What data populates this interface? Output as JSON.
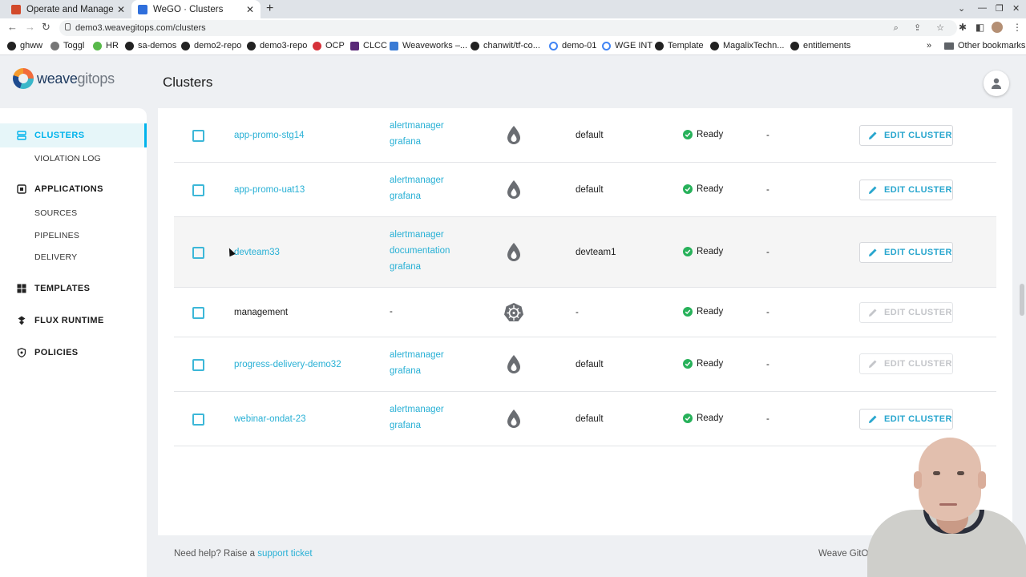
{
  "browser": {
    "tabs": [
      {
        "title": "Operate and Manage Kub",
        "active": false,
        "favicon_color": "#d24a2b"
      },
      {
        "title": "WeGO · Clusters",
        "active": true,
        "favicon_color": "#2f6fdc"
      }
    ],
    "url": "demo3.weavegitops.com/clusters",
    "bookmarks": [
      {
        "label": "ghww",
        "icon": "github-icon"
      },
      {
        "label": "Toggl",
        "icon": "toggl-icon"
      },
      {
        "label": "HR",
        "icon": "hr-icon"
      },
      {
        "label": "sa-demos",
        "icon": "github-icon"
      },
      {
        "label": "demo2-repo",
        "icon": "github-icon"
      },
      {
        "label": "demo3-repo",
        "icon": "github-icon"
      },
      {
        "label": "OCP",
        "icon": "openshift-icon"
      },
      {
        "label": "CLCC",
        "icon": "clcc-icon"
      },
      {
        "label": "Weaveworks –...",
        "icon": "weaveworks-icon"
      },
      {
        "label": "chanwit/tf-co...",
        "icon": "github-icon"
      },
      {
        "label": "demo-01",
        "icon": "google-icon"
      },
      {
        "label": "WGE INT",
        "icon": "google-icon"
      },
      {
        "label": "Template",
        "icon": "github-icon"
      },
      {
        "label": "MagalixTechn...",
        "icon": "github-icon"
      },
      {
        "label": "entitlements",
        "icon": "github-icon"
      }
    ],
    "bookmarks_more": "»",
    "other_bookmarks": "Other bookmarks"
  },
  "app": {
    "logo_weave": "weave",
    "logo_gitops": "gitops",
    "page_title": "Clusters"
  },
  "sidebar": {
    "items": [
      {
        "label": "CLUSTERS",
        "icon": "clusters-icon",
        "active": true
      },
      {
        "label": "VIOLATION LOG",
        "sub": true
      },
      {
        "label": "APPLICATIONS",
        "icon": "applications-icon"
      },
      {
        "label": "SOURCES",
        "sub": true
      },
      {
        "label": "PIPELINES",
        "sub": true
      },
      {
        "label": "DELIVERY",
        "sub": true
      },
      {
        "label": "TEMPLATES",
        "icon": "templates-icon"
      },
      {
        "label": "FLUX RUNTIME",
        "icon": "flux-icon"
      },
      {
        "label": "POLICIES",
        "icon": "policies-icon"
      }
    ]
  },
  "clusters": {
    "rows": [
      {
        "name": "app-promo-stg14",
        "name_is_link": true,
        "apps": [
          "alertmanager",
          "grafana"
        ],
        "type_icon": "vcluster-icon",
        "namespace": "default",
        "status": "Ready",
        "pr": "-",
        "edit_label": "EDIT CLUSTER",
        "edit_enabled": true
      },
      {
        "name": "app-promo-uat13",
        "name_is_link": true,
        "apps": [
          "alertmanager",
          "grafana"
        ],
        "type_icon": "vcluster-icon",
        "namespace": "default",
        "status": "Ready",
        "pr": "-",
        "edit_label": "EDIT CLUSTER",
        "edit_enabled": true
      },
      {
        "name": "devteam33",
        "name_is_link": true,
        "apps": [
          "alertmanager",
          "documentation",
          "grafana"
        ],
        "type_icon": "vcluster-icon",
        "namespace": "devteam1",
        "status": "Ready",
        "pr": "-",
        "edit_label": "EDIT CLUSTER",
        "edit_enabled": true
      },
      {
        "name": "management",
        "name_is_link": false,
        "apps": [
          "-"
        ],
        "type_icon": "kubernetes-icon",
        "namespace": "-",
        "status": "Ready",
        "pr": "-",
        "edit_label": "EDIT CLUSTER",
        "edit_enabled": false
      },
      {
        "name": "progress-delivery-demo32",
        "name_is_link": true,
        "apps": [
          "alertmanager",
          "grafana"
        ],
        "type_icon": "vcluster-icon",
        "namespace": "default",
        "status": "Ready",
        "pr": "-",
        "edit_label": "EDIT CLUSTER",
        "edit_enabled": false
      },
      {
        "name": "webinar-ondat-23",
        "name_is_link": true,
        "apps": [
          "alertmanager",
          "grafana"
        ],
        "type_icon": "vcluster-icon",
        "namespace": "default",
        "status": "Ready",
        "pr": "-",
        "edit_label": "EDIT CLUSTER",
        "edit_enabled": true
      }
    ]
  },
  "footer": {
    "help_prefix": "Need help? Raise a ",
    "help_link": "support ticket",
    "right_text": "Weave GitO"
  },
  "colors": {
    "accent": "#28b0d5",
    "ready": "#27b15a",
    "disabled": "#c4c6ca"
  }
}
